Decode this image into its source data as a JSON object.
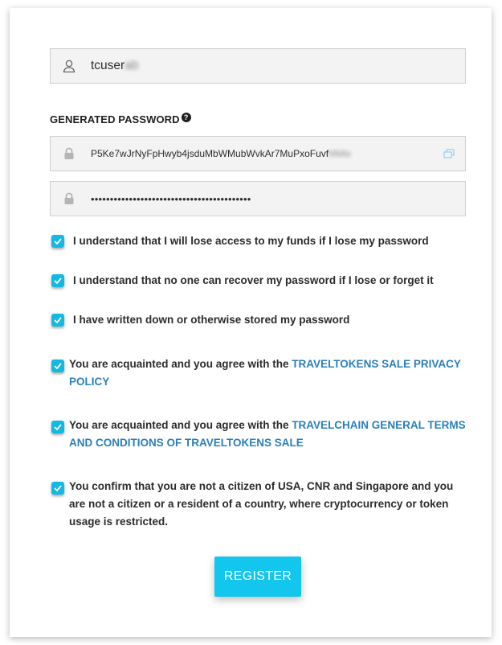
{
  "username": {
    "value": "tcuser",
    "masked_suffix": "ab"
  },
  "password_section": {
    "label": "GENERATED PASSWORD"
  },
  "generated_password": {
    "value": "P5Ke7wJrNyFpHwyb4jsduMbWMubWvkAr7MuPxoFuvf",
    "masked_suffix": "hN4x"
  },
  "confirm_password": {
    "value": "••••••••••••••••••••••••••••••••••••••••••"
  },
  "checks": [
    {
      "text": "I understand that I will lose access to my funds if I lose my password",
      "checked": true
    },
    {
      "text": "I understand that no one can recover my password if I lose or forget it",
      "checked": true
    },
    {
      "text": "I have written down or otherwise stored my password",
      "checked": true
    },
    {
      "text": "You are acquainted and you agree with the ",
      "link": "TRAVELTOKENS SALE PRIVACY POLICY",
      "checked": true
    },
    {
      "text": "You are acquainted and you agree with the ",
      "link": "TRAVELCHAIN GENERAL TERMS AND CONDITIONS OF TRAVELTOKENS SALE",
      "checked": true
    },
    {
      "text": "You confirm that you are not a citizen of USA, CNR and Singapore and you are not a citizen or a resident of a country, where cryptocurrency or token usage is restricted.",
      "checked": true
    }
  ],
  "register_label": "REGISTER",
  "colors": {
    "accent": "#12b9e3",
    "link": "#2a7fb8",
    "button": "#12c6ee"
  }
}
